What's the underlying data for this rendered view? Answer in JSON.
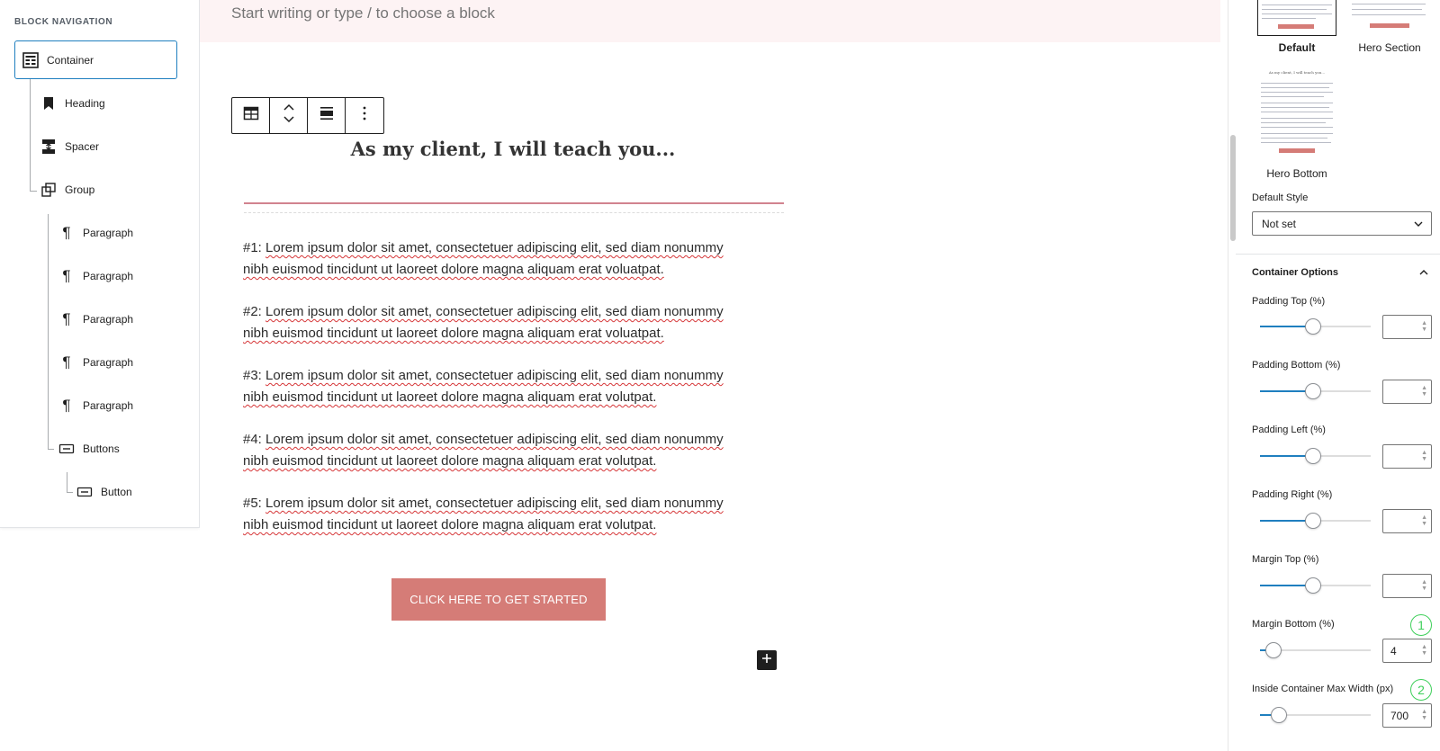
{
  "block_navigation": {
    "title": "BLOCK NAVIGATION",
    "items": [
      {
        "label": "Container",
        "icon": "container-icon"
      },
      {
        "label": "Heading",
        "icon": "bookmark-icon"
      },
      {
        "label": "Spacer",
        "icon": "spacer-icon"
      },
      {
        "label": "Group",
        "icon": "group-icon"
      },
      {
        "label": "Paragraph",
        "icon": "pilcrow-icon"
      },
      {
        "label": "Paragraph",
        "icon": "pilcrow-icon"
      },
      {
        "label": "Paragraph",
        "icon": "pilcrow-icon"
      },
      {
        "label": "Paragraph",
        "icon": "pilcrow-icon"
      },
      {
        "label": "Paragraph",
        "icon": "pilcrow-icon"
      },
      {
        "label": "Buttons",
        "icon": "buttons-icon"
      },
      {
        "label": "Button",
        "icon": "button-icon"
      }
    ]
  },
  "editor": {
    "placeholder": "Start writing or type / to choose a block",
    "heading": "As my client, I will teach you...",
    "paragraphs": [
      {
        "n": "#1:",
        "line1": "Lorem ipsum dolor sit amet, consectetuer adipiscing elit, sed diam nonummy",
        "line2": "nibh euismod tincidunt ut laoreet dolore magna aliquam erat voluatpat."
      },
      {
        "n": "#2:",
        "line1": "Lorem ipsum dolor sit amet, consectetuer adipiscing elit, sed diam nonummy",
        "line2": "nibh euismod tincidunt ut laoreet dolore magna aliquam erat voluatpat."
      },
      {
        "n": "#3:",
        "line1": "Lorem ipsum dolor sit amet, consectetuer adipiscing elit, sed diam nonummy",
        "line2": "nibh euismod tincidunt ut laoreet dolore magna aliquam erat volutpat."
      },
      {
        "n": "#4:",
        "line1": "Lorem ipsum dolor sit amet, consectetuer adipiscing elit, sed diam nonummy",
        "line2": "nibh euismod tincidunt ut laoreet dolore magna aliquam erat volutpat."
      },
      {
        "n": "#5:",
        "line1": "Lorem ipsum dolor sit amet, consectetuer adipiscing elit, sed diam nonummy",
        "line2": "nibh euismod tincidunt ut laoreet dolore magna aliquam erat volutpat."
      }
    ],
    "cta_label": "CLICK HERE TO GET STARTED",
    "toolbar_icons": [
      "table-icon",
      "move-up-down-icon",
      "align-icon",
      "more-options-icon"
    ]
  },
  "sidebar": {
    "styles": [
      {
        "label": "Default",
        "selected": true
      },
      {
        "label": "Hero Section",
        "selected": false
      },
      {
        "label": "Hero Bottom",
        "selected": false
      }
    ],
    "hero_bottom_preview_title": "As my client, I will teach you...",
    "default_style_label": "Default Style",
    "default_style_value": "Not set",
    "container_options_title": "Container Options",
    "controls": [
      {
        "label": "Padding Top (%)",
        "value": "",
        "level": 0.48
      },
      {
        "label": "Padding Bottom (%)",
        "value": "",
        "level": 0.48
      },
      {
        "label": "Padding Left (%)",
        "value": "",
        "level": 0.48
      },
      {
        "label": "Padding Right (%)",
        "value": "",
        "level": 0.48
      },
      {
        "label": "Margin Top (%)",
        "value": "",
        "level": 0.48
      },
      {
        "label": "Margin Bottom (%)",
        "value": "4",
        "level": 0.12,
        "badge": "1"
      },
      {
        "label": "Inside Container Max Width (px)",
        "value": "700",
        "level": 0.17,
        "badge": "2"
      }
    ]
  },
  "colors": {
    "accent_blue": "#1f7fbf",
    "cta_pink": "#d57c77",
    "separator_pink": "#d1838f",
    "badge_green": "#3ecf5a"
  }
}
